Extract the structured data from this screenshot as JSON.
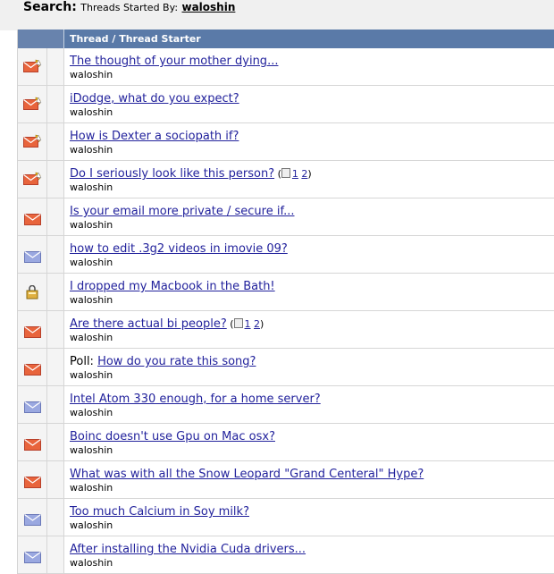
{
  "search": {
    "label": "Search:",
    "description": "Threads Started By:",
    "user": "waloshin"
  },
  "table": {
    "column_header": "Thread / Thread Starter"
  },
  "colors": {
    "header_bg": "#5a7aa8",
    "link": "#22229c",
    "envelope_red": "#e8643c",
    "envelope_blue": "#9aa8e0"
  },
  "threads": [
    {
      "prefix": "",
      "title": "The thought of your mother dying...",
      "starter": "waloshin",
      "icon": "hot-envelope-icon",
      "pages": []
    },
    {
      "prefix": "",
      "title": "iDodge, what do you expect?",
      "starter": "waloshin",
      "icon": "hot-envelope-icon",
      "pages": []
    },
    {
      "prefix": "",
      "title": "How is Dexter a sociopath if?",
      "starter": "waloshin",
      "icon": "hot-envelope-icon",
      "pages": []
    },
    {
      "prefix": "",
      "title": "Do I seriously look like this person?",
      "starter": "waloshin",
      "icon": "hot-envelope-icon",
      "pages": [
        "1",
        "2"
      ]
    },
    {
      "prefix": "",
      "title": "Is your email more private / secure if...",
      "starter": "waloshin",
      "icon": "red-envelope-icon",
      "pages": []
    },
    {
      "prefix": "",
      "title": "how to edit .3g2 videos in imovie 09?",
      "starter": "waloshin",
      "icon": "blue-envelope-icon",
      "pages": []
    },
    {
      "prefix": "",
      "title": "I dropped my Macbook in the Bath!",
      "starter": "waloshin",
      "icon": "locked-thread-icon",
      "pages": []
    },
    {
      "prefix": "",
      "title": "Are there actual bi people?",
      "starter": "waloshin",
      "icon": "red-envelope-icon",
      "pages": [
        "1",
        "2"
      ]
    },
    {
      "prefix": "Poll:",
      "title": "How do you rate this song?",
      "starter": "waloshin",
      "icon": "red-envelope-icon",
      "pages": []
    },
    {
      "prefix": "",
      "title": "Intel Atom 330 enough, for a home server?",
      "starter": "waloshin",
      "icon": "blue-envelope-icon",
      "pages": []
    },
    {
      "prefix": "",
      "title": "Boinc doesn't use Gpu on Mac osx?",
      "starter": "waloshin",
      "icon": "red-envelope-icon",
      "pages": []
    },
    {
      "prefix": "",
      "title": "What was with all the Snow Leopard \"Grand Centeral\" Hype?",
      "starter": "waloshin",
      "icon": "red-envelope-icon",
      "pages": []
    },
    {
      "prefix": "",
      "title": "Too much Calcium in Soy milk?",
      "starter": "waloshin",
      "icon": "blue-envelope-icon",
      "pages": []
    },
    {
      "prefix": "",
      "title": "After installing the Nvidia Cuda drivers...",
      "starter": "waloshin",
      "icon": "blue-envelope-icon",
      "pages": []
    }
  ]
}
